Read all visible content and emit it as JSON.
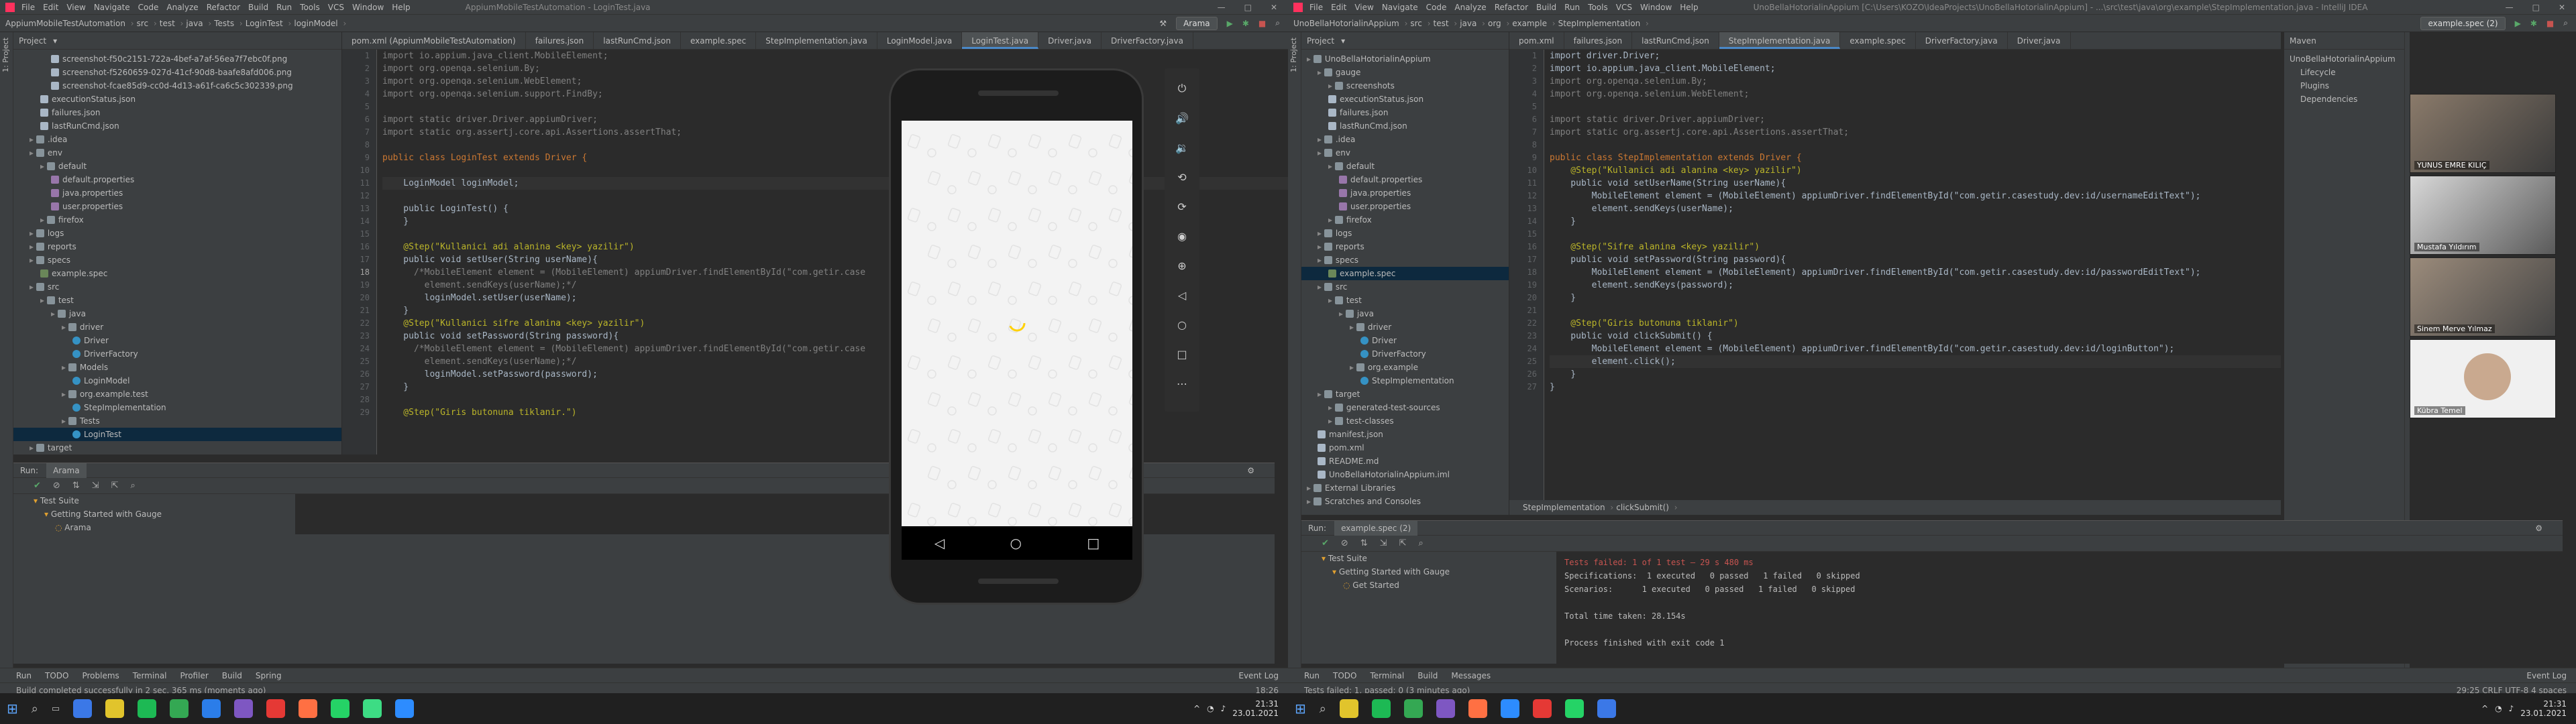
{
  "left": {
    "menu": [
      "File",
      "Edit",
      "View",
      "Navigate",
      "Code",
      "Analyze",
      "Refactor",
      "Build",
      "Run",
      "Tools",
      "VCS",
      "Window",
      "Help"
    ],
    "title": "AppiumMobileTestAutomation - LoginTest.java",
    "breadcrumb": [
      "AppiumMobileTestAutomation",
      "src",
      "test",
      "java",
      "Tests",
      "LoginTest",
      "loginModel"
    ],
    "run_config": "Arama",
    "project_label": "Project",
    "tree": [
      {
        "label": "screenshot-f50c2151-722a-4bef-a7af-56ea7f7ebc0f.png",
        "indent": 3,
        "icon": "file"
      },
      {
        "label": "screenshot-f5260659-027d-41cf-90d8-baafe8afd006.png",
        "indent": 3,
        "icon": "file"
      },
      {
        "label": "screenshot-fcae85d9-cc0d-4d13-a61f-ca6c5c302339.png",
        "indent": 3,
        "icon": "file"
      },
      {
        "label": "executionStatus.json",
        "indent": 2,
        "icon": "file"
      },
      {
        "label": "failures.json",
        "indent": 2,
        "icon": "file"
      },
      {
        "label": "lastRunCmd.json",
        "indent": 2,
        "icon": "file"
      },
      {
        "label": ".idea",
        "indent": 1,
        "icon": "folder"
      },
      {
        "label": "env",
        "indent": 1,
        "icon": "folder"
      },
      {
        "label": "default",
        "indent": 2,
        "icon": "folder"
      },
      {
        "label": "default.properties",
        "indent": 3,
        "icon": "prop"
      },
      {
        "label": "java.properties",
        "indent": 3,
        "icon": "prop"
      },
      {
        "label": "user.properties",
        "indent": 3,
        "icon": "prop"
      },
      {
        "label": "firefox",
        "indent": 2,
        "icon": "folder"
      },
      {
        "label": "logs",
        "indent": 1,
        "icon": "folder"
      },
      {
        "label": "reports",
        "indent": 1,
        "icon": "folder"
      },
      {
        "label": "specs",
        "indent": 1,
        "icon": "folder"
      },
      {
        "label": "example.spec",
        "indent": 2,
        "icon": "spec"
      },
      {
        "label": "src",
        "indent": 1,
        "icon": "folder"
      },
      {
        "label": "test",
        "indent": 2,
        "icon": "folder"
      },
      {
        "label": "java",
        "indent": 3,
        "icon": "folder"
      },
      {
        "label": "driver",
        "indent": 4,
        "icon": "folder"
      },
      {
        "label": "Driver",
        "indent": 5,
        "icon": "java"
      },
      {
        "label": "DriverFactory",
        "indent": 5,
        "icon": "java"
      },
      {
        "label": "Models",
        "indent": 4,
        "icon": "folder"
      },
      {
        "label": "LoginModel",
        "indent": 5,
        "icon": "java"
      },
      {
        "label": "org.example.test",
        "indent": 4,
        "icon": "folder"
      },
      {
        "label": "StepImplementation",
        "indent": 5,
        "icon": "java"
      },
      {
        "label": "Tests",
        "indent": 4,
        "icon": "folder"
      },
      {
        "label": "LoginTest",
        "indent": 5,
        "icon": "java",
        "sel": true
      },
      {
        "label": "target",
        "indent": 1,
        "icon": "folder"
      }
    ],
    "tabs": [
      "pom.xml (AppiumMobileTestAutomation)",
      "failures.json",
      "lastRunCmd.json",
      "example.spec",
      "StepImplementation.java",
      "LoginModel.java",
      "LoginTest.java",
      "Driver.java",
      "DriverFactory.java"
    ],
    "active_tab": 6,
    "line_start": 1,
    "current_line": 18,
    "code": [
      {
        "t": "import io.appium.java_client.MobileElement;",
        "c": "imp"
      },
      {
        "t": "import org.openqa.selenium.By;",
        "c": "imp"
      },
      {
        "t": "import org.openqa.selenium.WebElement;",
        "c": "imp"
      },
      {
        "t": "import org.openqa.selenium.support.FindBy;",
        "c": "imp"
      },
      {
        "t": "",
        "c": ""
      },
      {
        "t": "import static driver.Driver.appiumDriver;",
        "c": "imp"
      },
      {
        "t": "import static org.assertj.core.api.Assertions.assertThat;",
        "c": "imp"
      },
      {
        "t": "",
        "c": ""
      },
      {
        "t": "public class LoginTest extends Driver {",
        "c": "kw"
      },
      {
        "t": "",
        "c": ""
      },
      {
        "t": "    LoginModel loginModel;",
        "c": "cur"
      },
      {
        "t": "",
        "c": ""
      },
      {
        "t": "    public LoginTest() {",
        "c": ""
      },
      {
        "t": "    }",
        "c": ""
      },
      {
        "t": "",
        "c": ""
      },
      {
        "t": "    @Step(\"Kullanici adi alanina <key> yazilir\")",
        "c": "ann"
      },
      {
        "t": "    public void setUser(String userName){",
        "c": ""
      },
      {
        "t": "      /*MobileElement element = (MobileElement) appiumDriver.findElementById(\"com.getir.case",
        "c": "imp"
      },
      {
        "t": "        element.sendKeys(userName);*/",
        "c": "imp"
      },
      {
        "t": "        loginModel.setUser(userName);",
        "c": ""
      },
      {
        "t": "    }",
        "c": ""
      },
      {
        "t": "    @Step(\"Kullanici sifre alanina <key> yazilir\")",
        "c": "ann"
      },
      {
        "t": "    public void setPassword(String password){",
        "c": ""
      },
      {
        "t": "      /*MobileElement element = (MobileElement) appiumDriver.findElementById(\"com.getir.case",
        "c": "imp"
      },
      {
        "t": "        element.sendKeys(userName);*/",
        "c": "imp"
      },
      {
        "t": "        loginModel.setPassword(password);",
        "c": ""
      },
      {
        "t": "    }",
        "c": ""
      },
      {
        "t": "",
        "c": ""
      },
      {
        "t": "    @Step(\"Giris butonuna tiklanir.\")",
        "c": "ann"
      }
    ],
    "run": {
      "label": "Run:",
      "tab": "Arama",
      "tree": [
        "Test Suite",
        "Getting Started with Gauge",
        "Arama"
      ]
    },
    "bottom_tabs": [
      "Run",
      "TODO",
      "Problems",
      "Terminal",
      "Profiler",
      "Build",
      "Spring"
    ],
    "event_log": "Event Log",
    "status": "Build completed successfully in 2 sec, 365 ms (moments ago)",
    "status_right": "18:26"
  },
  "emulator": {
    "nav": [
      "◁",
      "○",
      "□"
    ]
  },
  "right": {
    "menu": [
      "File",
      "Edit",
      "View",
      "Navigate",
      "Code",
      "Analyze",
      "Refactor",
      "Build",
      "Run",
      "Tools",
      "VCS",
      "Window",
      "Help"
    ],
    "title": "UnoBellaHotorialinAppium [C:\\Users\\KOZO\\IdeaProjects\\UnoBellaHotorialinAppium] - ...\\src\\test\\java\\org\\example\\StepImplementation.java - IntelliJ IDEA",
    "breadcrumb": [
      "UnoBellaHotorialinAppium",
      "src",
      "test",
      "java",
      "org",
      "example",
      "StepImplementation"
    ],
    "run_config": "example.spec (2)",
    "project_label": "Project",
    "tree": [
      {
        "label": "UnoBellaHotorialinAppium",
        "indent": 0,
        "icon": "folder"
      },
      {
        "label": "gauge",
        "indent": 1,
        "icon": "folder"
      },
      {
        "label": "screenshots",
        "indent": 2,
        "icon": "folder"
      },
      {
        "label": "executionStatus.json",
        "indent": 2,
        "icon": "file"
      },
      {
        "label": "failures.json",
        "indent": 2,
        "icon": "file"
      },
      {
        "label": "lastRunCmd.json",
        "indent": 2,
        "icon": "file"
      },
      {
        "label": ".idea",
        "indent": 1,
        "icon": "folder"
      },
      {
        "label": "env",
        "indent": 1,
        "icon": "folder"
      },
      {
        "label": "default",
        "indent": 2,
        "icon": "folder"
      },
      {
        "label": "default.properties",
        "indent": 3,
        "icon": "prop"
      },
      {
        "label": "java.properties",
        "indent": 3,
        "icon": "prop"
      },
      {
        "label": "user.properties",
        "indent": 3,
        "icon": "prop"
      },
      {
        "label": "firefox",
        "indent": 2,
        "icon": "folder"
      },
      {
        "label": "logs",
        "indent": 1,
        "icon": "folder"
      },
      {
        "label": "reports",
        "indent": 1,
        "icon": "folder"
      },
      {
        "label": "specs",
        "indent": 1,
        "icon": "folder"
      },
      {
        "label": "example.spec",
        "indent": 2,
        "icon": "spec",
        "sel": true
      },
      {
        "label": "src",
        "indent": 1,
        "icon": "folder"
      },
      {
        "label": "test",
        "indent": 2,
        "icon": "folder"
      },
      {
        "label": "java",
        "indent": 3,
        "icon": "folder"
      },
      {
        "label": "driver",
        "indent": 4,
        "icon": "folder"
      },
      {
        "label": "Driver",
        "indent": 5,
        "icon": "java"
      },
      {
        "label": "DriverFactory",
        "indent": 5,
        "icon": "java"
      },
      {
        "label": "org.example",
        "indent": 4,
        "icon": "folder"
      },
      {
        "label": "StepImplementation",
        "indent": 5,
        "icon": "java"
      },
      {
        "label": "target",
        "indent": 1,
        "icon": "folder"
      },
      {
        "label": "generated-test-sources",
        "indent": 2,
        "icon": "folder"
      },
      {
        "label": "test-classes",
        "indent": 2,
        "icon": "folder"
      },
      {
        "label": "manifest.json",
        "indent": 1,
        "icon": "file"
      },
      {
        "label": "pom.xml",
        "indent": 1,
        "icon": "file"
      },
      {
        "label": "README.md",
        "indent": 1,
        "icon": "file"
      },
      {
        "label": "UnoBellaHotorialinAppium.iml",
        "indent": 1,
        "icon": "file"
      },
      {
        "label": "External Libraries",
        "indent": 0,
        "icon": "folder"
      },
      {
        "label": "Scratches and Consoles",
        "indent": 0,
        "icon": "folder"
      }
    ],
    "tabs": [
      "pom.xml",
      "failures.json",
      "lastRunCmd.json",
      "StepImplementation.java",
      "example.spec",
      "DriverFactory.java",
      "Driver.java"
    ],
    "active_tab": 3,
    "line_start": 1,
    "current_line": 29,
    "code": [
      {
        "t": "import driver.Driver;",
        "c": ""
      },
      {
        "t": "import io.appium.java_client.MobileElement;",
        "c": ""
      },
      {
        "t": "import org.openqa.selenium.By;",
        "c": "imp"
      },
      {
        "t": "import org.openqa.selenium.WebElement;",
        "c": "imp"
      },
      {
        "t": "",
        "c": ""
      },
      {
        "t": "import static driver.Driver.appiumDriver;",
        "c": "imp"
      },
      {
        "t": "import static org.assertj.core.api.Assertions.assertThat;",
        "c": "imp"
      },
      {
        "t": "",
        "c": ""
      },
      {
        "t": "public class StepImplementation extends Driver {",
        "c": "kw"
      },
      {
        "t": "    @Step(\"Kullanici adi alanina <key> yazilir\")",
        "c": "ann"
      },
      {
        "t": "    public void setUserName(String userName){",
        "c": ""
      },
      {
        "t": "        MobileElement element = (MobileElement) appiumDriver.findElementById(\"com.getir.casestudy.dev:id/usernameEditText\");",
        "c": ""
      },
      {
        "t": "        element.sendKeys(userName);",
        "c": ""
      },
      {
        "t": "    }",
        "c": ""
      },
      {
        "t": "",
        "c": ""
      },
      {
        "t": "    @Step(\"Sifre alanina <key> yazilir\")",
        "c": "ann"
      },
      {
        "t": "    public void setPassword(String password){",
        "c": ""
      },
      {
        "t": "        MobileElement element = (MobileElement) appiumDriver.findElementById(\"com.getir.casestudy.dev:id/passwordEditText\");",
        "c": ""
      },
      {
        "t": "        element.sendKeys(password);",
        "c": ""
      },
      {
        "t": "    }",
        "c": ""
      },
      {
        "t": "",
        "c": ""
      },
      {
        "t": "    @Step(\"Giris butonuna tiklanir\")",
        "c": "ann"
      },
      {
        "t": "    public void clickSubmit() {",
        "c": ""
      },
      {
        "t": "        MobileElement element = (MobileElement) appiumDriver.findElementById(\"com.getir.casestudy.dev:id/loginButton\");",
        "c": ""
      },
      {
        "t": "        element.click();",
        "c": "cur"
      },
      {
        "t": "    }",
        "c": ""
      },
      {
        "t": "}",
        "c": ""
      }
    ],
    "breadcrumb_bottom": [
      "StepImplementation",
      "clickSubmit()"
    ],
    "maven_label": "Maven",
    "maven_tree": [
      "UnoBellaHotorialinAppium",
      "Lifecycle",
      "Plugins",
      "Dependencies"
    ],
    "run": {
      "label": "Run:",
      "tab": "example.spec (2)",
      "tree": [
        "Test Suite",
        "Getting Started with Gauge",
        "Get Started"
      ],
      "console": [
        "Tests failed: 1 of 1 test – 29 s 480 ms",
        "Specifications:  1 executed   0 passed   1 failed   0 skipped",
        "Scenarios:      1 executed   0 passed   1 failed   0 skipped",
        "",
        "Total time taken: 28.154s",
        "",
        "Process finished with exit code 1"
      ]
    },
    "bottom_tabs": [
      "Run",
      "TODO",
      "Terminal",
      "Build",
      "Messages"
    ],
    "event_log": "Event Log",
    "status": "Tests failed: 1, passed: 0 (3 minutes ago)",
    "status_right": "29:25  CRLF  UTF-8  4 spaces"
  },
  "video": {
    "names": [
      "YUNUS EMRE KILIÇ",
      "Mustafa Yıldırım",
      "Sinem Merve Yılmaz",
      "Kübra Temel"
    ]
  },
  "taskbar": {
    "time": "21:31",
    "date": "23.01.2021"
  }
}
